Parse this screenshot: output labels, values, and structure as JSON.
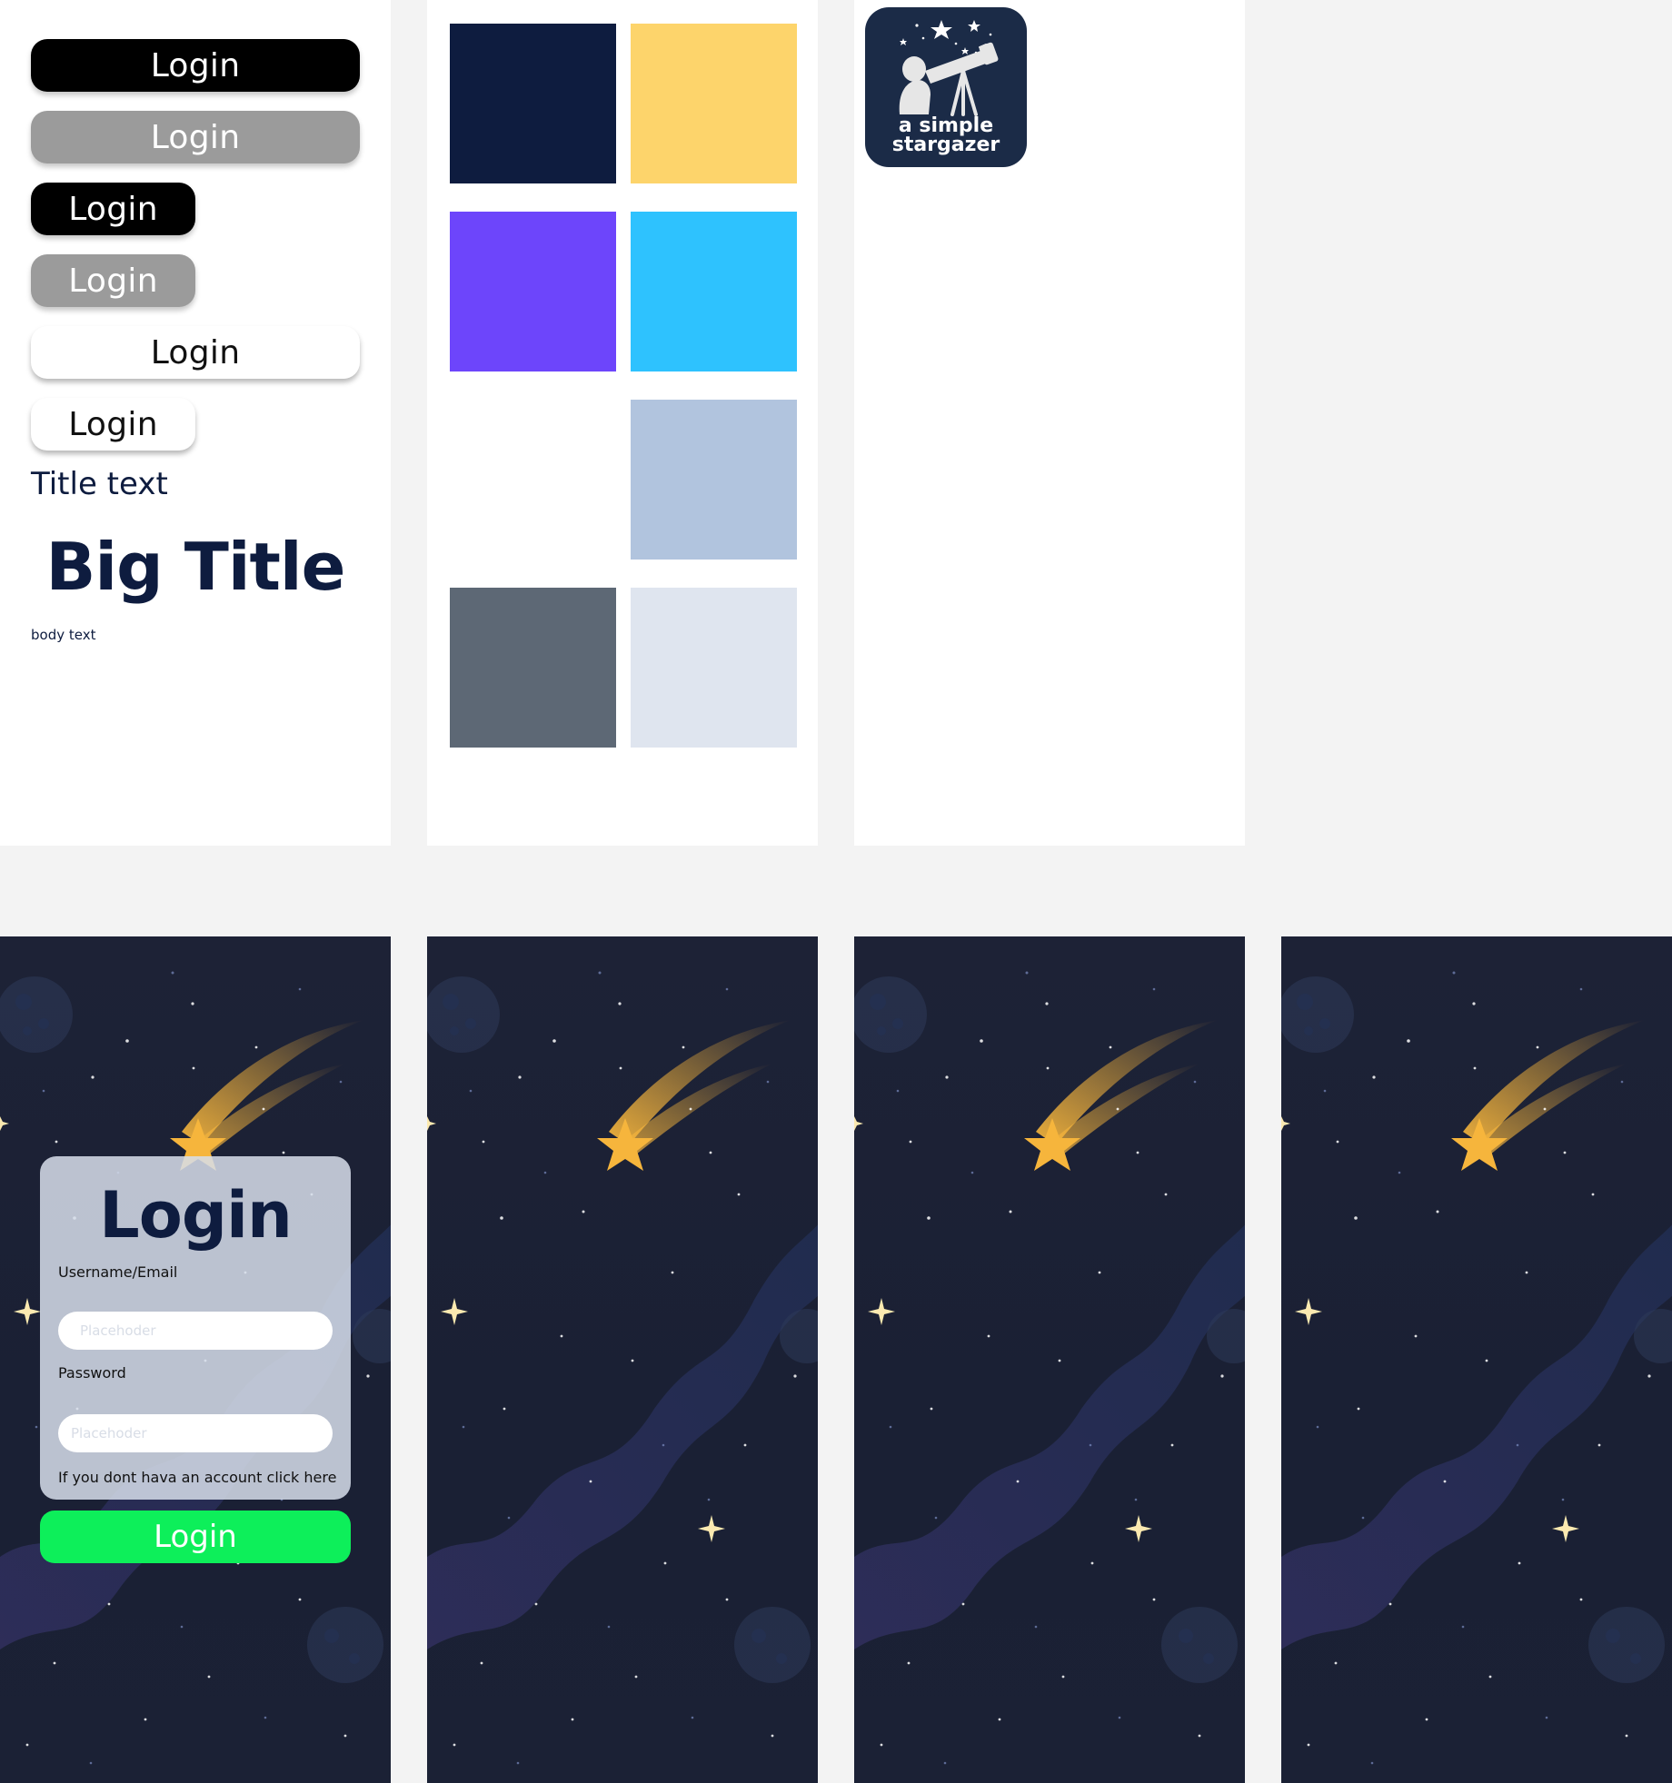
{
  "components": {
    "buttons": [
      {
        "label": "Login",
        "variant": "black",
        "size": "wide"
      },
      {
        "label": "Login",
        "variant": "gray",
        "size": "wide"
      },
      {
        "label": "Login",
        "variant": "black",
        "size": "narrow"
      },
      {
        "label": "Login",
        "variant": "gray",
        "size": "narrow"
      },
      {
        "label": "Login",
        "variant": "white",
        "size": "wide"
      },
      {
        "label": "Login",
        "variant": "white",
        "size": "narrow"
      }
    ],
    "title_text": "Title text",
    "big_title": "Big Title",
    "body_text": "body text"
  },
  "palette": {
    "colors": [
      "#0e1c3f",
      "#fdd46b",
      "#6d45fb",
      "#2ec2fe",
      "#ffffff",
      "#b1c4de",
      "#5d6875",
      "#dfe5ef"
    ]
  },
  "logo": {
    "line1": "a simple",
    "line2": "stargazer",
    "icon": "stargazer-telescope-icon",
    "background": "#1b2b47"
  },
  "login_screen": {
    "title": "Login",
    "username_label": "Username/Email",
    "username_placeholder": "Placehoder",
    "password_label": "Password",
    "password_placeholder": "Placehoder",
    "signup_hint": "If you dont hava an account click here",
    "submit_label": "Login",
    "submit_color": "#0def5a"
  },
  "theme": {
    "night_sky": "#1c2135",
    "shooting_star": "#f6b53c",
    "sparkle": "#fbe9b0"
  }
}
